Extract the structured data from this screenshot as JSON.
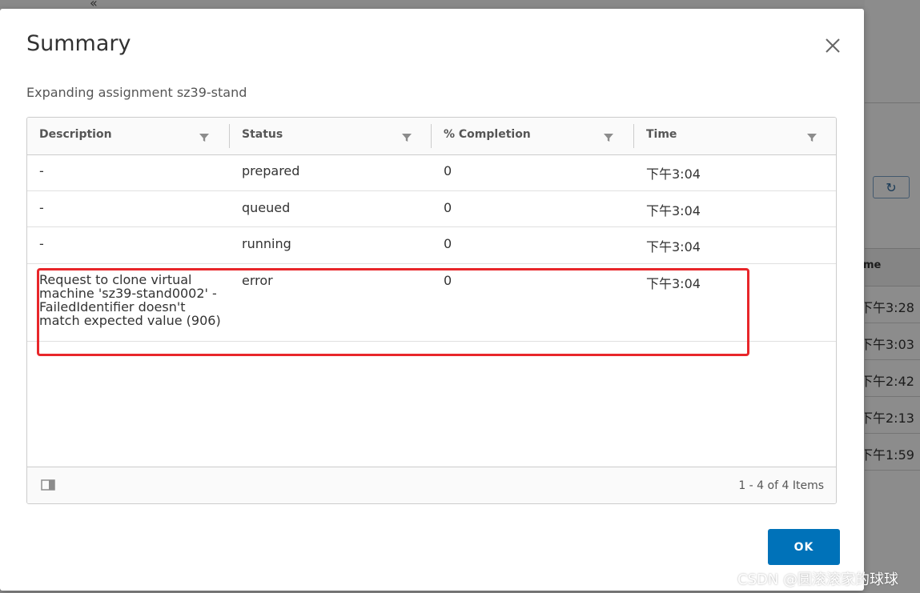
{
  "background": {
    "column_header": "me",
    "times": [
      "下午3:28",
      "下午3:03",
      "下午2:42",
      "下午2:13",
      "下午1:59"
    ]
  },
  "dialog": {
    "title": "Summary",
    "subtitle": "Expanding assignment sz39-stand",
    "ok_label": "OK"
  },
  "table": {
    "columns": [
      "Description",
      "Status",
      "% Completion",
      "Time"
    ],
    "rows": [
      {
        "description": "-",
        "status": "prepared",
        "completion": "0",
        "time": "下午3:04"
      },
      {
        "description": "-",
        "status": "queued",
        "completion": "0",
        "time": "下午3:04"
      },
      {
        "description": "-",
        "status": "running",
        "completion": "0",
        "time": "下午3:04"
      },
      {
        "description": "Request to clone virtual machine 'sz39-stand0002' - FailedIdentifier doesn't match expected value (906)",
        "status": "error",
        "completion": "0",
        "time": "下午3:04"
      }
    ],
    "pagination": "1 - 4 of 4 Items"
  },
  "watermark": "CSDN @圆滚滚家的球球",
  "colors": {
    "primary": "#0072b9",
    "highlight": "#e8262a"
  },
  "icons": {
    "close": "close-icon",
    "filter": "filter-icon",
    "column_toggle": "column-toggle-icon",
    "refresh": "refresh-icon"
  }
}
